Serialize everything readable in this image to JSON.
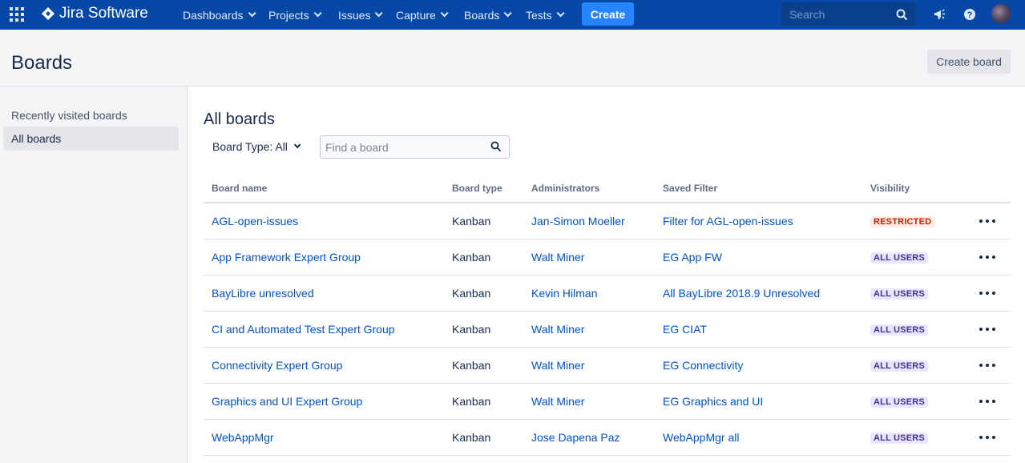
{
  "topnav": {
    "logo_text": "Jira Software",
    "menus": [
      {
        "label": "Dashboards"
      },
      {
        "label": "Projects"
      },
      {
        "label": "Issues"
      },
      {
        "label": "Capture"
      },
      {
        "label": "Boards"
      },
      {
        "label": "Tests"
      }
    ],
    "create_label": "Create",
    "search_placeholder": "Search",
    "brand_color": "#0747a6",
    "accent_color": "#2684ff",
    "icons": [
      "app-switcher-icon",
      "jira-logo-icon",
      "search-icon",
      "megaphone-icon",
      "help-icon",
      "avatar"
    ]
  },
  "header": {
    "title": "Boards",
    "create_board_label": "Create board"
  },
  "sidebar": {
    "items": [
      {
        "label": "Recently visited boards",
        "active": false
      },
      {
        "label": "All boards",
        "active": true
      }
    ]
  },
  "main": {
    "title": "All boards",
    "board_type_filter": "Board Type: All",
    "find_placeholder": "Find a board",
    "columns": [
      "Board name",
      "Board type",
      "Administrators",
      "Saved Filter",
      "Visibility"
    ],
    "rows": [
      {
        "name": "AGL-open-issues",
        "type": "Kanban",
        "admin": "Jan-Simon Moeller",
        "filter": "Filter for AGL-open-issues",
        "visibility": "RESTRICTED"
      },
      {
        "name": "App Framework Expert Group",
        "type": "Kanban",
        "admin": "Walt Miner",
        "filter": "EG App FW",
        "visibility": "ALL USERS"
      },
      {
        "name": "BayLibre unresolved",
        "type": "Kanban",
        "admin": "Kevin Hilman",
        "filter": "All BayLibre 2018.9 Unresolved",
        "visibility": "ALL USERS"
      },
      {
        "name": "CI and Automated Test Expert Group",
        "type": "Kanban",
        "admin": "Walt Miner",
        "filter": "EG CIAT",
        "visibility": "ALL USERS"
      },
      {
        "name": "Connectivity Expert Group",
        "type": "Kanban",
        "admin": "Walt Miner",
        "filter": "EG Connectivity",
        "visibility": "ALL USERS"
      },
      {
        "name": "Graphics and UI Expert Group",
        "type": "Kanban",
        "admin": "Walt Miner",
        "filter": "EG Graphics and UI",
        "visibility": "ALL USERS"
      },
      {
        "name": "WebAppMgr",
        "type": "Kanban",
        "admin": "Jose Dapena Paz",
        "filter": "WebAppMgr all",
        "visibility": "ALL USERS"
      }
    ]
  }
}
